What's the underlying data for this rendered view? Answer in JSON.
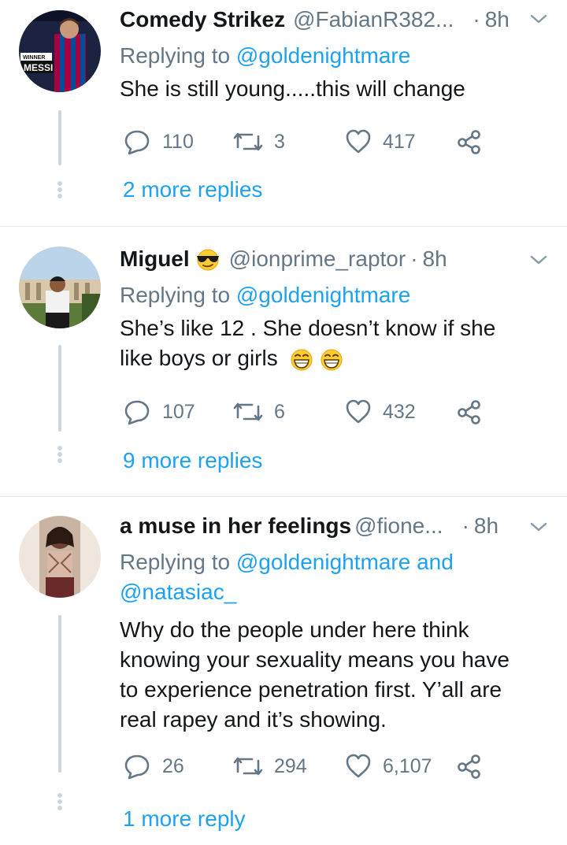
{
  "tweets": [
    {
      "name": "Comedy Strikez",
      "handle": "@FabianR382...",
      "time": "8h",
      "replying_prefix": "Replying to ",
      "replying_to": "@goldenightmare",
      "text_lines": [
        "She is still young.....this will change"
      ],
      "replies": "110",
      "retweets": "3",
      "likes": "417",
      "more_replies": "2 more replies",
      "avatar_text": [
        "WINNER",
        "MESSI"
      ]
    },
    {
      "name": "Miguel",
      "name_emoji": "sunglasses-emoji",
      "handle": "@ionprime_raptor",
      "time": "8h",
      "replying_prefix": "Replying to ",
      "replying_to": "@goldenightmare",
      "text_lines": [
        "She’s like 12 . She doesn’t know if she",
        "like boys or girls"
      ],
      "text_emoji": "laughing-emoji",
      "replies": "107",
      "retweets": "6",
      "likes": "432",
      "more_replies": "9 more replies"
    },
    {
      "name": "a muse in her feelings",
      "handle": "@fione...",
      "time": "8h",
      "replying_prefix": "Replying to ",
      "replying_to": "@goldenightmare and",
      "replying_to_2": "@natasiac_",
      "text_lines": [
        "Why do the people under here think",
        "knowing your sexuality means you have",
        "to experience penetration first. Y’all are",
        "real rapey and it’s showing."
      ],
      "replies": "26",
      "retweets": "294",
      "likes": "6,107",
      "more_replies": "1 more reply"
    }
  ],
  "colors": {
    "link": "#1da1f2",
    "muted": "#657786",
    "text": "#14171a",
    "line": "#ccd6dd"
  }
}
